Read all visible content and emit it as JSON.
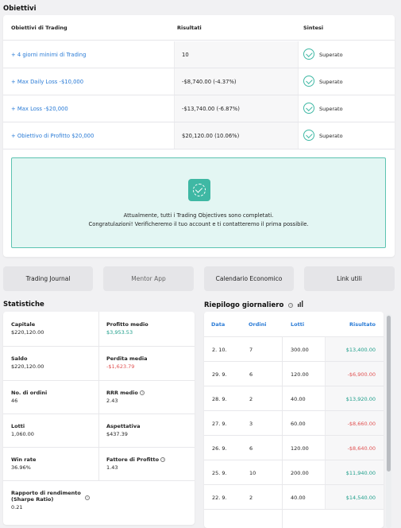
{
  "objectives": {
    "title": "Obiettivi",
    "headers": {
      "objective": "Obiettivi di Trading",
      "result": "Risultati",
      "summary": "Sintesi"
    },
    "rows": [
      {
        "name": "+ 4 giorni minimi di Trading",
        "result": "10",
        "status": "Superato"
      },
      {
        "name": "+ Max Daily Loss -$10,000",
        "result": "-$8,740.00 (-4.37%)",
        "status": "Superato"
      },
      {
        "name": "+ Max Loss -$20,000",
        "result": "-$13,740.00 (-6.87%)",
        "status": "Superato"
      },
      {
        "name": "+ Obiettivo di Profitto $20,000",
        "result": "$20,120.00 (10.06%)",
        "status": "Superato"
      }
    ],
    "congrats_line1": "Attualmente, tutti i Trading Objectives sono completati.",
    "congrats_line2": "Congratulazioni! Verificheremo il tuo account e ti contatteremo il prima possibile."
  },
  "nav_buttons": [
    "Trading Journal",
    "Mentor App",
    "Calendario Economico",
    "Link utili"
  ],
  "statistics": {
    "title": "Statistiche",
    "left": [
      {
        "label": "Capitale",
        "value": "$220,120.00"
      },
      {
        "label": "Saldo",
        "value": "$220,120.00"
      },
      {
        "label": "No. di ordini",
        "value": "46"
      },
      {
        "label": "Lotti",
        "value": "1,060.00"
      },
      {
        "label": "Win rate",
        "value": "36.96%"
      },
      {
        "label": "Rapporto di rendimento",
        "label2": "(Sharpe Ratio)",
        "value": "0.21"
      }
    ],
    "right": [
      {
        "label": "Profitto medio",
        "value": "$3,953.53"
      },
      {
        "label": "Perdita media",
        "value": "-$1,623.79"
      },
      {
        "label": "RRR medio",
        "value": "2.43"
      },
      {
        "label": "Aspettativa",
        "value": "$437.39"
      },
      {
        "label": "Fattore di Profitto",
        "value": "1.43"
      }
    ],
    "info_glyph": "i"
  },
  "daily": {
    "title": "Riepilogo giornaliero",
    "headers": {
      "date": "Data",
      "orders": "Ordini",
      "lots": "Lotti",
      "result": "Risultato"
    },
    "rows": [
      {
        "date": "2. 10.",
        "orders": "7",
        "lots": "300.00",
        "result": "$13,400.00"
      },
      {
        "date": "29. 9.",
        "orders": "6",
        "lots": "120.00",
        "result": "-$6,900.00"
      },
      {
        "date": "28. 9.",
        "orders": "2",
        "lots": "40.00",
        "result": "$13,920.00"
      },
      {
        "date": "27. 9.",
        "orders": "3",
        "lots": "60.00",
        "result": "-$8,660.00"
      },
      {
        "date": "26. 9.",
        "orders": "6",
        "lots": "120.00",
        "result": "-$8,640.00"
      },
      {
        "date": "25. 9.",
        "orders": "10",
        "lots": "200.00",
        "result": "$11,940.00"
      },
      {
        "date": "22. 9.",
        "orders": "2",
        "lots": "40.00",
        "result": "$14,540.00"
      }
    ]
  },
  "colors": {
    "accent": "#2a7bd6",
    "success": "#1e9e8a",
    "danger": "#e05252",
    "success_bg": "#e3f6f3"
  }
}
